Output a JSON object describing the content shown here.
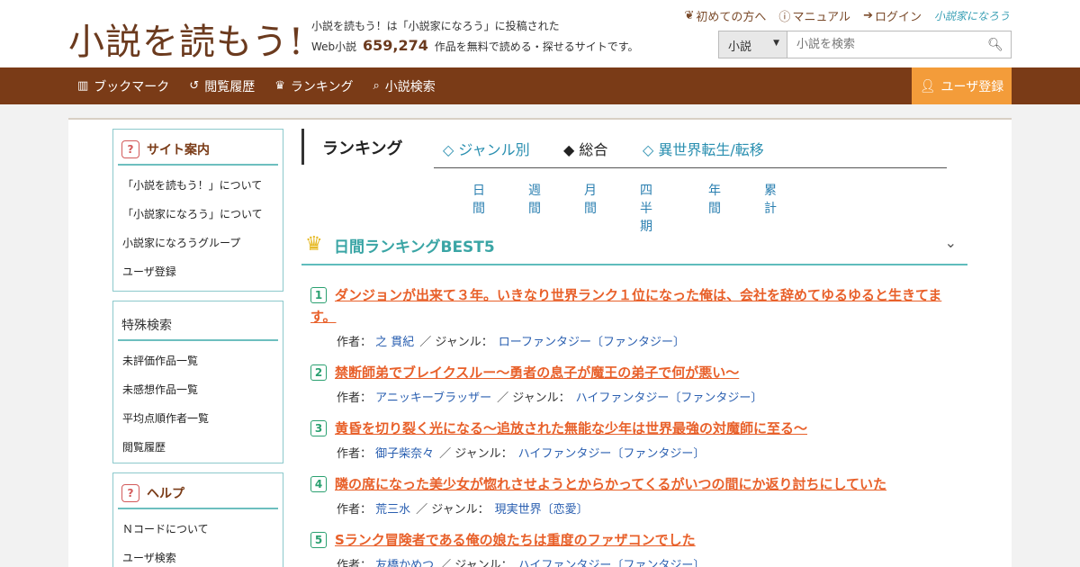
{
  "header": {
    "logo_main": "小説を読もう",
    "logo_bang": "!",
    "tagline_line1": "小説を読もう！は「小説家になろう」に投稿された",
    "tagline_prefix": "Web小説",
    "work_count": "659,274",
    "tagline_suffix": "作品を無料で読める・探せるサイトです。",
    "links": {
      "beginner": "初めての方へ",
      "manual": "マニュアル",
      "login": "ログイン",
      "narou": "小説家になろう"
    },
    "search": {
      "category": "小説",
      "placeholder": "小説を検索"
    }
  },
  "nav": {
    "items": [
      {
        "icon": "bookshelf-icon",
        "label": "ブックマーク"
      },
      {
        "icon": "history-icon",
        "label": "閲覧履歴"
      },
      {
        "icon": "crown-icon",
        "label": "ランキング"
      },
      {
        "icon": "search-icon",
        "label": "小説検索"
      }
    ],
    "register": "ユーザ登録"
  },
  "sidebar": {
    "site_guide": {
      "title": "サイト案内",
      "items": [
        "「小説を読もう！」について",
        "「小説家になろう」について",
        "小説家になろうグループ",
        "ユーザ登録"
      ]
    },
    "special_search": {
      "title": "特殊検索",
      "items": [
        "未評価作品一覧",
        "未感想作品一覧",
        "平均点順作者一覧",
        "閲覧履歴"
      ]
    },
    "help": {
      "title": "ヘルプ",
      "items": [
        "Ｎコードについて",
        "ユーザ検索"
      ]
    }
  },
  "ranking": {
    "title": "ランキング",
    "tabs": [
      {
        "label": "◇ ジャンル別",
        "active": false
      },
      {
        "label": "◆ 総合",
        "active": true
      },
      {
        "label": "◇ 異世界転生/転移",
        "active": false
      }
    ],
    "periods": [
      "日間",
      "週間",
      "月間",
      "四半期",
      "年間",
      "累計"
    ],
    "best_title": "日間ランキングBEST5",
    "author_label": "作者：",
    "genre_label": "／ ジャンル：",
    "entries": [
      {
        "rank": "1",
        "title": "ダンジョンが出来て３年。いきなり世界ランク１位になった俺は、会社を辞めてゆるゆると生きてます。",
        "author": "之 貫紀",
        "genre": "ローファンタジー〔ファンタジー〕"
      },
      {
        "rank": "2",
        "title": "禁断師弟でブレイクスルー～勇者の息子が魔王の弟子で何が悪い～",
        "author": "アニッキーブラッザー",
        "genre": "ハイファンタジー〔ファンタジー〕"
      },
      {
        "rank": "3",
        "title": "黄昏を切り裂く光になる〜追放された無能な少年は世界最強の対魔師に至る〜",
        "author": "御子柴奈々",
        "genre": "ハイファンタジー〔ファンタジー〕"
      },
      {
        "rank": "4",
        "title": "隣の席になった美少女が惚れさせようとからかってくるがいつの間にか返り討ちにしていた",
        "author": "荒三水",
        "genre": "現実世界〔恋愛〕"
      },
      {
        "rank": "5",
        "title": "Sランク冒険者である俺の娘たちは重度のファザコンでした",
        "author": "友橋かめつ",
        "genre": "ハイファンタジー〔ファンタジー〕"
      }
    ]
  }
}
